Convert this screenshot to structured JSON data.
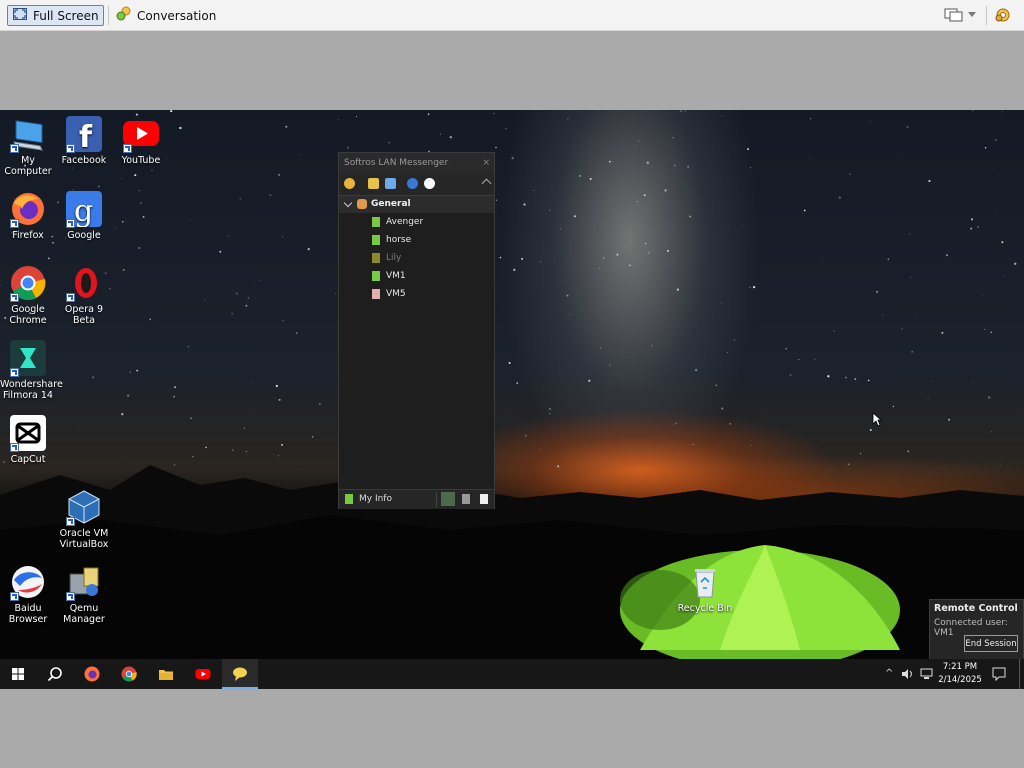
{
  "viewer": {
    "full_screen_label": "Full Screen",
    "conversation_label": "Conversation"
  },
  "desktop": {
    "icons": [
      {
        "label": "My\nComputer"
      },
      {
        "label": "Facebook"
      },
      {
        "label": "YouTube"
      },
      {
        "label": "Firefox"
      },
      {
        "label": "Google"
      },
      {
        "label": "Google\nChrome"
      },
      {
        "label": "Opera 9 Beta"
      },
      {
        "label": "Wondershare\nFilmora 14"
      },
      {
        "label": "CapCut"
      },
      {
        "label": "Oracle VM\nVirtualBox"
      },
      {
        "label": "Baidu\nBrowser"
      },
      {
        "label": "Qemu\nManager"
      },
      {
        "label": "Recycle Bin"
      }
    ]
  },
  "messenger": {
    "title": "Softros LAN Messenger",
    "group": "General",
    "contacts": [
      {
        "name": "Avenger",
        "status": "online"
      },
      {
        "name": "horse",
        "status": "online"
      },
      {
        "name": "Lily",
        "status": "offline"
      },
      {
        "name": "VM1",
        "status": "online"
      },
      {
        "name": "VM5",
        "status": "busy"
      }
    ],
    "my_info_label": "My Info"
  },
  "remote_control": {
    "title": "Remote Control",
    "connected_text": "Connected user: VM1",
    "end_session_label": "End Session"
  },
  "taskbar": {
    "time": "7:21 PM",
    "date": "2/14/2025"
  },
  "colors": {
    "taskbar": "#171717",
    "online": "#7ac943",
    "offline": "#8a8a2a",
    "busy": "#e0b0b0"
  }
}
